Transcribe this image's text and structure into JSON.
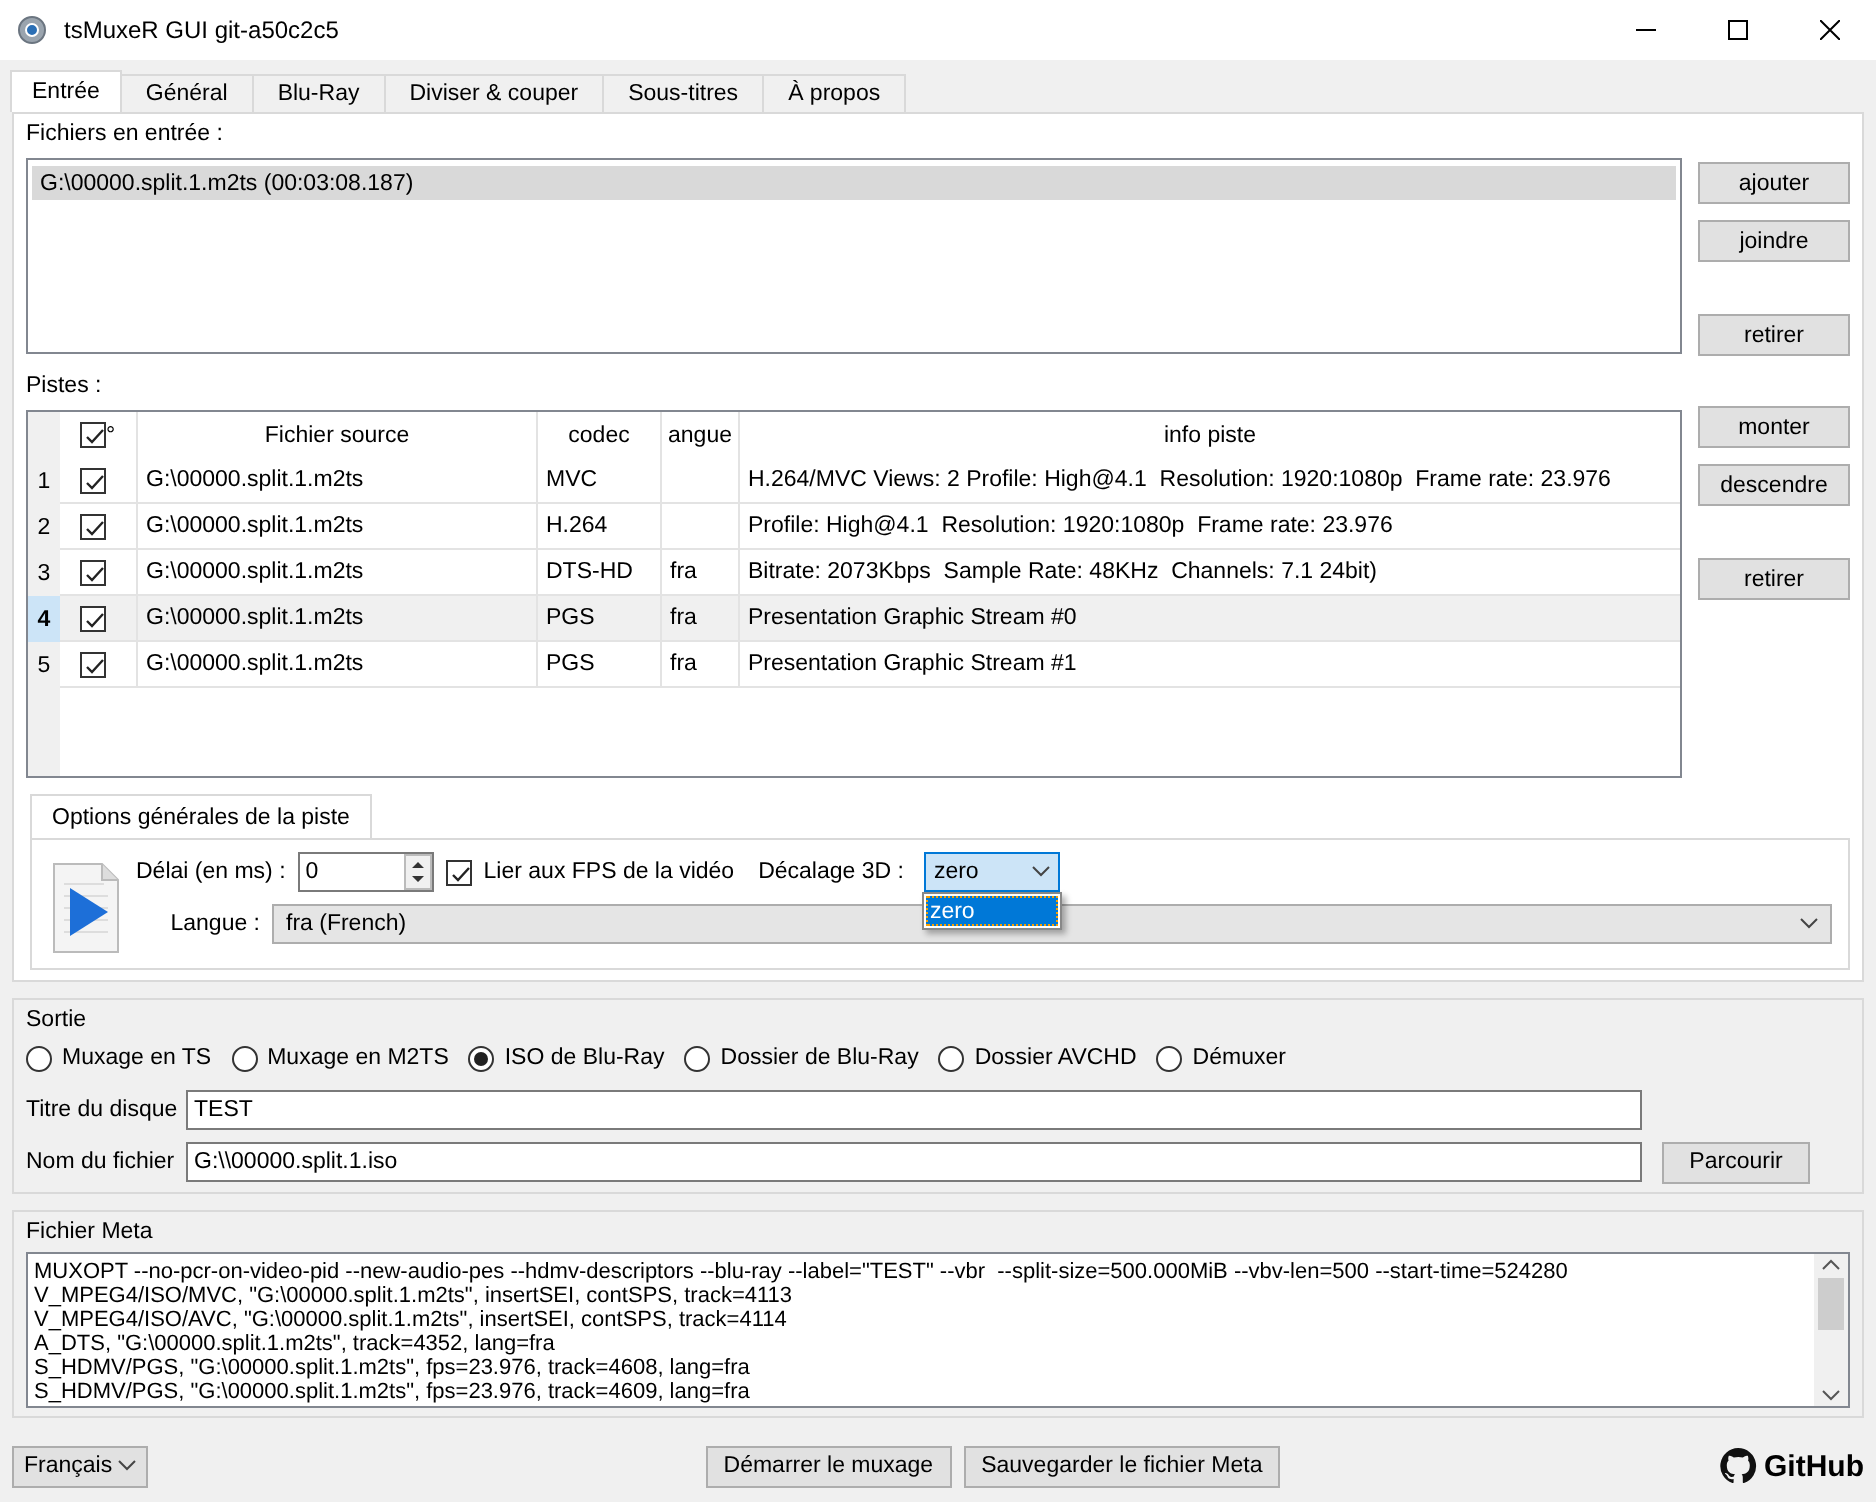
{
  "window": {
    "title": "tsMuxeR GUI git-a50c2c5"
  },
  "tabs": [
    {
      "label": "Entrée",
      "selected": true
    },
    {
      "label": "Général",
      "selected": false
    },
    {
      "label": "Blu-Ray",
      "selected": false
    },
    {
      "label": "Diviser & couper",
      "selected": false
    },
    {
      "label": "Sous-titres",
      "selected": false
    },
    {
      "label": "À propos",
      "selected": false
    }
  ],
  "input_files": {
    "label": "Fichiers en entrée :",
    "items": [
      {
        "text": "G:\\00000.split.1.m2ts (00:03:08.187)",
        "selected": true
      }
    ],
    "buttons": [
      "ajouter",
      "joindre",
      "retirer"
    ]
  },
  "tracks": {
    "label": "Pistes :",
    "header_checked": true,
    "columns": [
      "°",
      "Fichier source",
      "codec",
      "angue",
      "info piste"
    ],
    "rows": [
      {
        "number": "1",
        "checked": true,
        "selected": false,
        "source": "G:\\00000.split.1.m2ts",
        "codec": "MVC",
        "lang": "",
        "info": "H.264/MVC Views: 2 Profile: High@4.1  Resolution: 1920:1080p  Frame rate: 23.976"
      },
      {
        "number": "2",
        "checked": true,
        "selected": false,
        "source": "G:\\00000.split.1.m2ts",
        "codec": "H.264",
        "lang": "",
        "info": "Profile: High@4.1  Resolution: 1920:1080p  Frame rate: 23.976"
      },
      {
        "number": "3",
        "checked": true,
        "selected": false,
        "source": "G:\\00000.split.1.m2ts",
        "codec": "DTS-HD",
        "lang": "fra",
        "info": "Bitrate: 2073Kbps  Sample Rate: 48KHz  Channels: 7.1 24bit)"
      },
      {
        "number": "4",
        "checked": true,
        "selected": true,
        "source": "G:\\00000.split.1.m2ts",
        "codec": "PGS",
        "lang": "fra",
        "info": "Presentation Graphic Stream #0"
      },
      {
        "number": "5",
        "checked": true,
        "selected": false,
        "source": "G:\\00000.split.1.m2ts",
        "codec": "PGS",
        "lang": "fra",
        "info": "Presentation Graphic Stream #1"
      }
    ],
    "buttons": [
      "monter",
      "descendre",
      "retirer"
    ]
  },
  "track_options": {
    "tab": "Options générales de la piste",
    "delay_label": "Délai (en ms) :",
    "delay": "0",
    "fps_link": {
      "label": "Lier aux FPS de la vidéo",
      "checked": true
    },
    "offset_3d": {
      "label": "Décalage 3D :",
      "value": "zero",
      "expanded": true,
      "options": [
        {
          "label": "zero",
          "selected": true
        }
      ]
    },
    "language": {
      "label": "Langue :",
      "value": "fra (French)"
    }
  },
  "output": {
    "title": "Sortie",
    "modes": [
      {
        "label": "Muxage en TS",
        "selected": false
      },
      {
        "label": "Muxage en M2TS",
        "selected": false
      },
      {
        "label": "ISO de Blu-Ray",
        "selected": true
      },
      {
        "label": "Dossier de Blu-Ray",
        "selected": false
      },
      {
        "label": "Dossier AVCHD",
        "selected": false
      },
      {
        "label": "Démuxer",
        "selected": false
      }
    ],
    "disc_title": {
      "label": "Titre du disque",
      "value": "TEST"
    },
    "file_name": {
      "label": "Nom du fichier",
      "value": "G:\\\\00000.split.1.iso"
    },
    "browse_button": "Parcourir"
  },
  "meta": {
    "title": "Fichier Meta",
    "lines": [
      "MUXOPT --no-pcr-on-video-pid --new-audio-pes --hdmv-descriptors --blu-ray --label=\"TEST\" --vbr  --split-size=500.000MiB --vbv-len=500 --start-time=524280",
      "V_MPEG4/ISO/MVC, \"G:\\00000.split.1.m2ts\", insertSEI, contSPS, track=4113",
      "V_MPEG4/ISO/AVC, \"G:\\00000.split.1.m2ts\", insertSEI, contSPS, track=4114",
      "A_DTS, \"G:\\00000.split.1.m2ts\", track=4352, lang=fra",
      "S_HDMV/PGS, \"G:\\00000.split.1.m2ts\", fps=23.976, track=4608, lang=fra",
      "S_HDMV/PGS, \"G:\\00000.split.1.m2ts\", fps=23.976, track=4609, lang=fra"
    ]
  },
  "footer": {
    "language": "Français",
    "buttons": [
      "Démarrer le muxage",
      "Sauvegarder le fichier Meta"
    ],
    "github": "GitHub"
  }
}
